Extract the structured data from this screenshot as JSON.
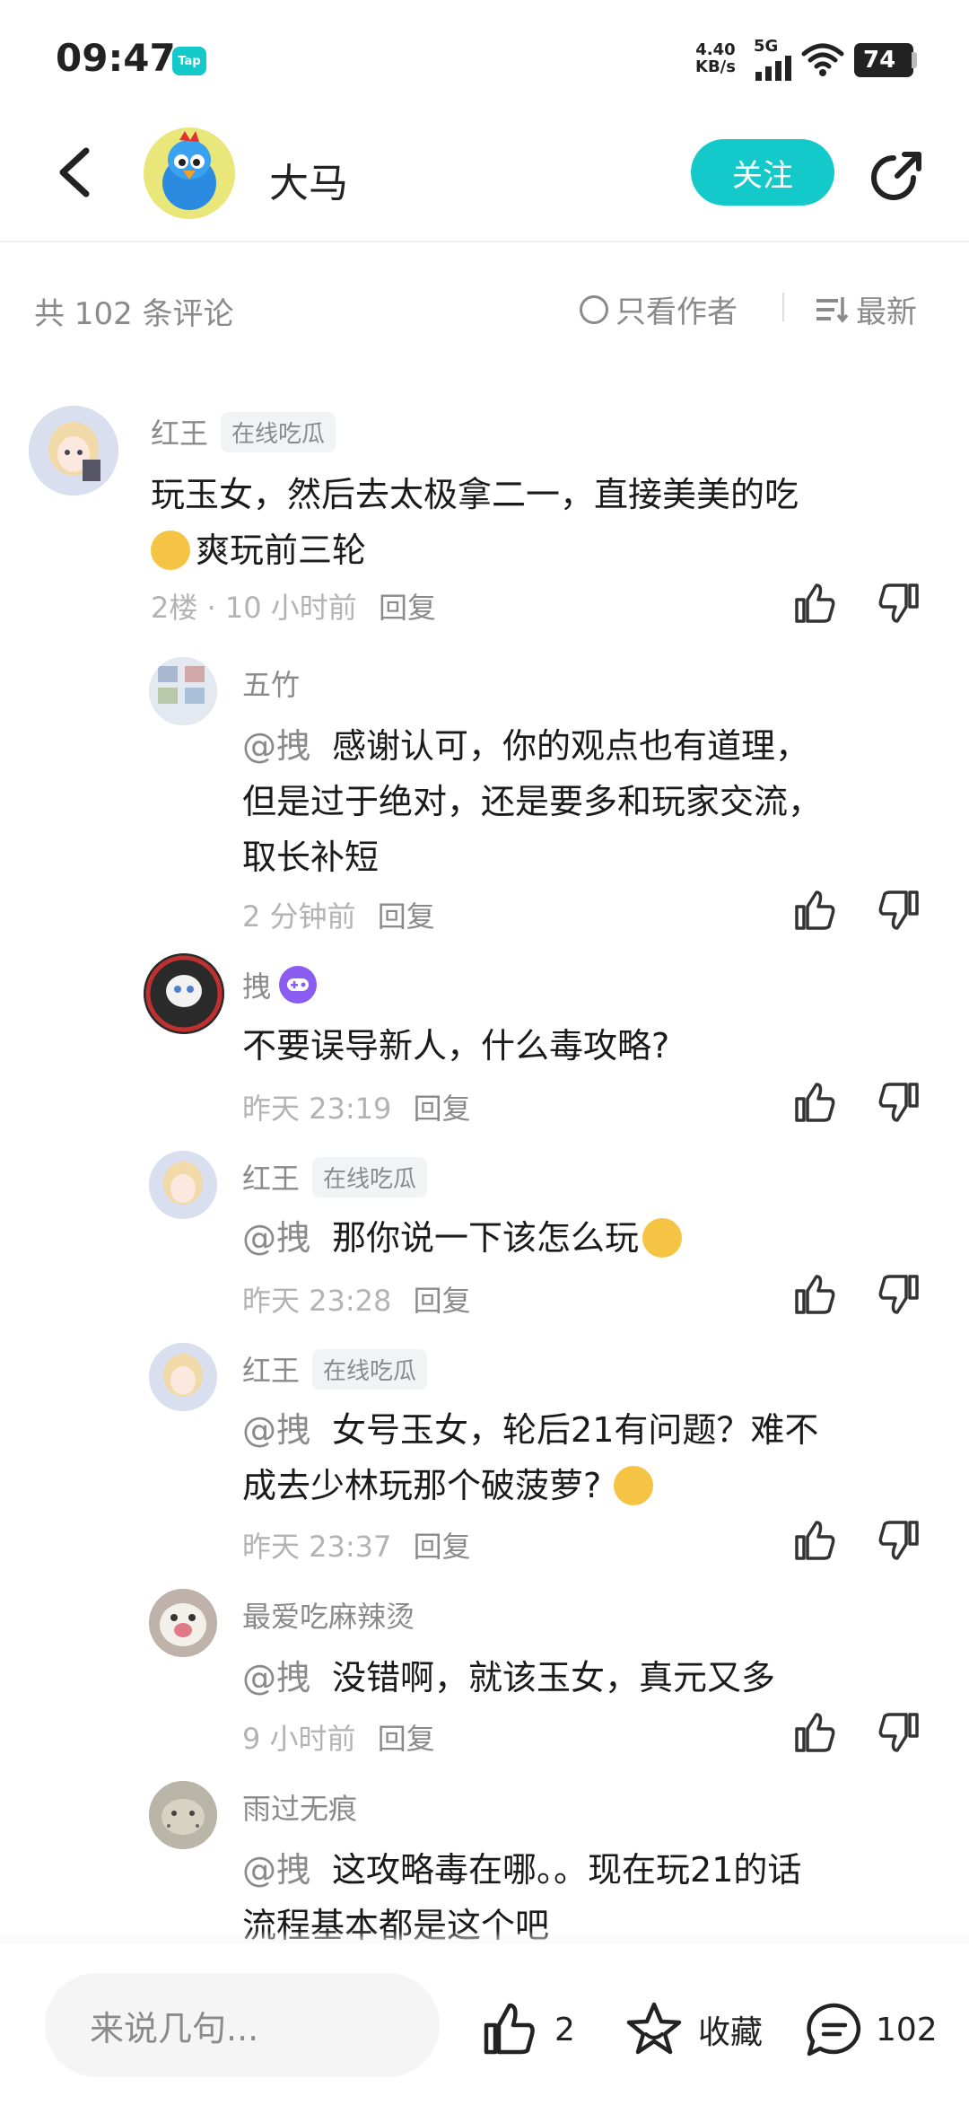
{
  "status_bar": {
    "time": "09:47",
    "tap_badge": "Tap",
    "net_speed_top": "4.40",
    "net_speed_bottom": "KB/s",
    "network": "5G",
    "battery": "74"
  },
  "header": {
    "author_name": "大马",
    "follow_label": "关注",
    "back_icon": "back-arrow-icon",
    "share_icon": "share-icon"
  },
  "comment_bar": {
    "count_label": "共 102 条评论",
    "filter_label": "只看作者",
    "sort_label": "最新"
  },
  "comments": [
    {
      "name": "红王",
      "tag": "在线吃瓜",
      "text_line1": "玩玉女，然后去太极拿二一，直接美美的吃",
      "text_line2": "爽玩前三轮",
      "meta": "2楼 · 10 小时前",
      "reply": "回复"
    },
    {
      "name": "五竹",
      "mention": "@拽",
      "text_line1": "感谢认可，你的观点也有道理，",
      "text_line2": "但是过于绝对，还是要多和玩家交流，",
      "text_line3": "取长补短",
      "meta": "2 分钟前",
      "reply": "回复"
    },
    {
      "name": "拽",
      "text_line1": "不要误导新人，什么毒攻略?",
      "meta": "昨天 23:19",
      "reply": "回复"
    },
    {
      "name": "红王",
      "tag": "在线吃瓜",
      "mention": "@拽",
      "text_line1": "那你说一下该怎么玩",
      "meta": "昨天 23:28",
      "reply": "回复"
    },
    {
      "name": "红王",
      "tag": "在线吃瓜",
      "mention": "@拽",
      "text_line1": "女号玉女，轮后21有问题？难不",
      "text_line2": "成去少林玩那个破菠萝?",
      "meta": "昨天 23:37",
      "reply": "回复"
    },
    {
      "name": "最爱吃麻辣烫",
      "mention": "@拽",
      "text_line1": "没错啊，就该玉女，真元又多",
      "meta": "9 小时前",
      "reply": "回复"
    },
    {
      "name": "雨过无痕",
      "mention": "@拽",
      "text_line1": "这攻略毒在哪。。现在玩21的话",
      "text_line2": "流程基本都是这个吧"
    }
  ],
  "bottom_bar": {
    "input_placeholder": "来说几句...",
    "like_count": "2",
    "favorite_label": "收藏",
    "comment_count": "102"
  },
  "colors": {
    "accent": "#14c9c9",
    "muted_text": "#8a8a8a",
    "light_text": "#b3b3b3"
  }
}
